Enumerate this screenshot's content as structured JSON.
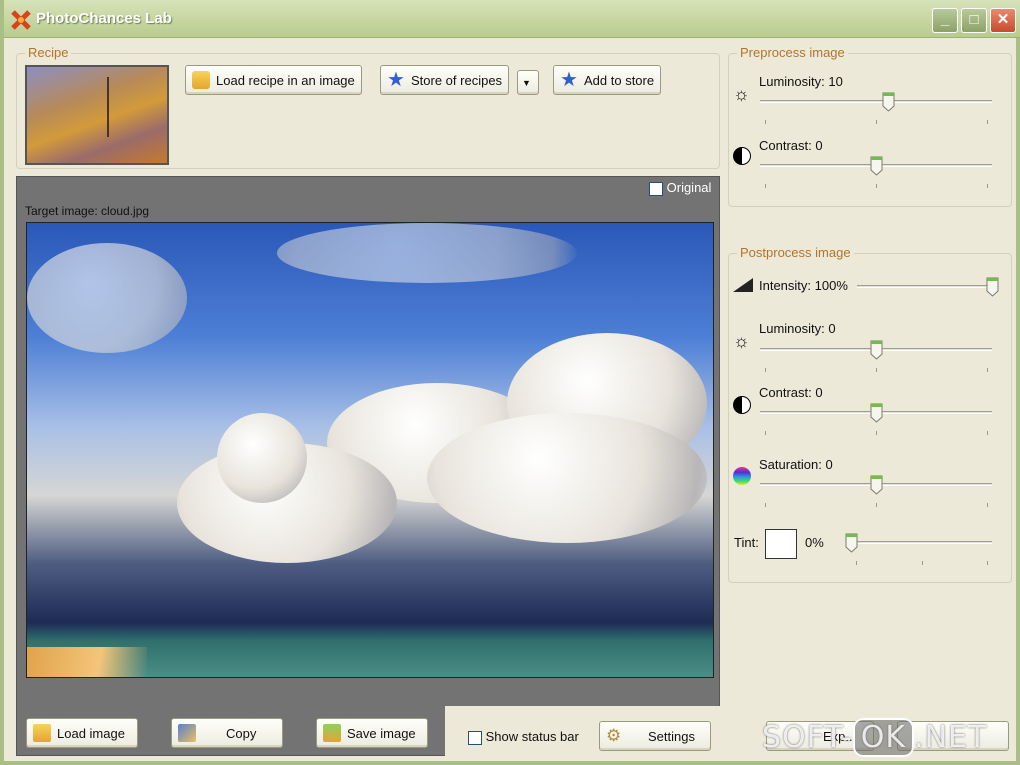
{
  "window": {
    "title": "PhotoChances Lab",
    "minimize": "_",
    "maximize": "□",
    "close": "✕"
  },
  "recipe": {
    "group_label": "Recipe",
    "load_recipe": "Load recipe in an image",
    "store": "Store of recipes",
    "add_store": "Add to store"
  },
  "target": {
    "label": "Target image: cloud.jpg",
    "original_label": "Original",
    "original_checked": false
  },
  "preprocess": {
    "label": "Preprocess image",
    "luminosity": {
      "label": "Luminosity: 10",
      "value": 10,
      "min": -100,
      "max": 100
    },
    "contrast": {
      "label": "Contrast: 0",
      "value": 0,
      "min": -100,
      "max": 100
    }
  },
  "postprocess": {
    "label": "Postprocess image",
    "intensity": {
      "label": "Intensity: 100%",
      "value": 100,
      "min": 0,
      "max": 100
    },
    "luminosity": {
      "label": "Luminosity: 0",
      "value": 0,
      "min": -100,
      "max": 100
    },
    "contrast": {
      "label": "Contrast: 0",
      "value": 0,
      "min": -100,
      "max": 100
    },
    "saturation": {
      "label": "Saturation: 0",
      "value": 0,
      "min": -100,
      "max": 100
    },
    "tint": {
      "label": "Tint:",
      "value_label": "0%",
      "value": 0,
      "color": "#ffffff"
    }
  },
  "bottom": {
    "load_image": "Load image",
    "copy": "Copy",
    "save_image": "Save image",
    "show_status": "Show status bar",
    "show_status_checked": false,
    "settings": "Settings",
    "export": "Exp..."
  },
  "watermark": "SOFT-OK.NET",
  "colors": {
    "group_label": "#b4742a",
    "title_bar": "#b8cc8e",
    "panel": "#737373"
  }
}
